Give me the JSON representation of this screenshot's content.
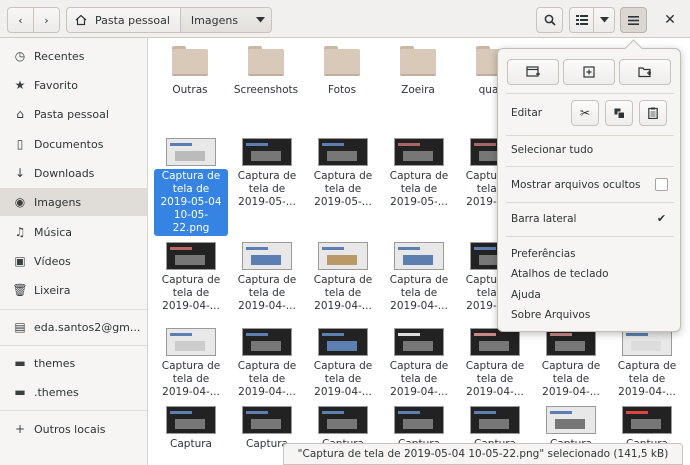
{
  "breadcrumb": {
    "home": "Pasta pessoal",
    "current": "Imagens"
  },
  "sidebar": {
    "items": [
      {
        "label": "Recentes",
        "icon": "clock-icon"
      },
      {
        "label": "Favorito",
        "icon": "star-icon"
      },
      {
        "label": "Pasta pessoal",
        "icon": "home-icon"
      },
      {
        "label": "Documentos",
        "icon": "document-icon"
      },
      {
        "label": "Downloads",
        "icon": "download-icon"
      },
      {
        "label": "Imagens",
        "icon": "camera-icon"
      },
      {
        "label": "Música",
        "icon": "music-icon"
      },
      {
        "label": "Vídeos",
        "icon": "video-icon"
      },
      {
        "label": "Lixeira",
        "icon": "trash-icon"
      },
      {
        "label": "eda.santos2@gm...",
        "icon": "account-icon"
      },
      {
        "label": "themes",
        "icon": "folder-icon"
      },
      {
        "label": ".themes",
        "icon": "folder-icon"
      },
      {
        "label": "Outros locais",
        "icon": "plus-icon"
      }
    ]
  },
  "folders": [
    "Outras",
    "Screenshots",
    "Fotos",
    "Zoeira",
    "quadr"
  ],
  "files": {
    "selected_label": "Captura de tela de 2019-05-04 10-05-22.png",
    "row2_label": "Captura de tela de 2019-05-...",
    "row3_label": "Captura de tela de 2019-04-...",
    "row4_label": "Captura de tela de 2019-04-...",
    "row5_label": "Captura"
  },
  "menu": {
    "edit_label": "Editar",
    "select_all": "Selecionar tudo",
    "show_hidden": "Mostrar arquivos ocultos",
    "show_hidden_checked": false,
    "sidebar": "Barra lateral",
    "sidebar_checked": true,
    "preferences": "Preferências",
    "shortcuts": "Atalhos de teclado",
    "help": "Ajuda",
    "about": "Sobre Arquivos"
  },
  "status": "\"Captura de tela de 2019-05-04 10-05-22.png\" selecionado (141,5 kB)"
}
